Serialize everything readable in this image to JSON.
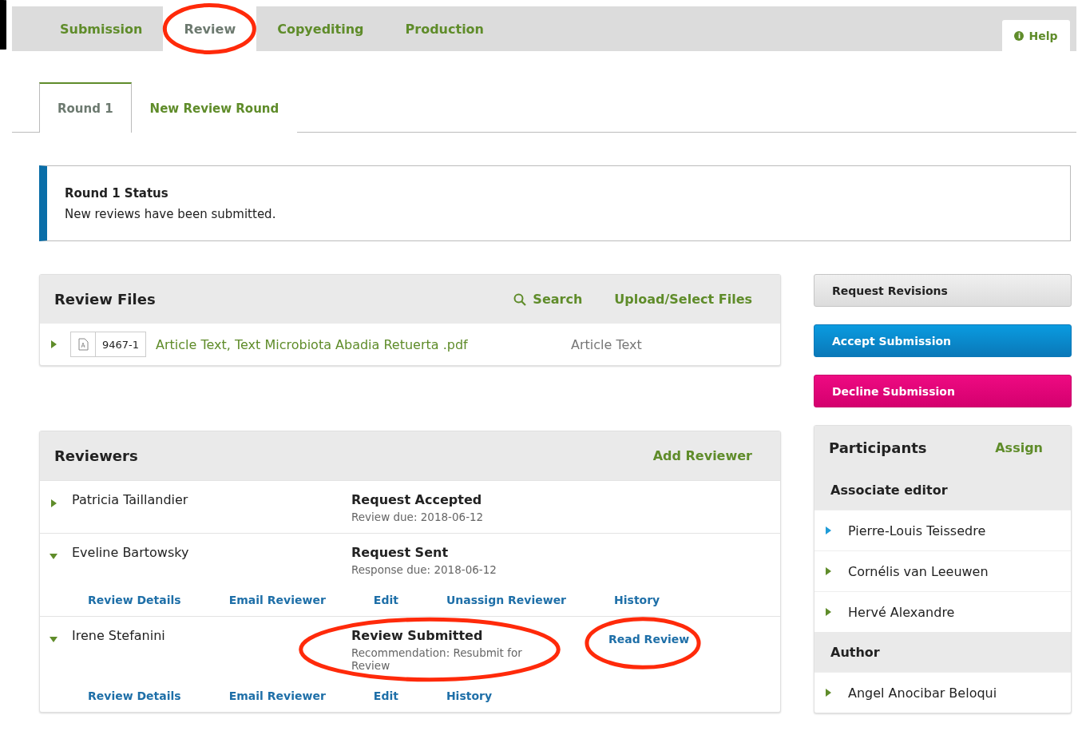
{
  "tabs": [
    {
      "label": "Submission",
      "selected": false,
      "circled": false
    },
    {
      "label": "Review",
      "selected": true,
      "circled": true
    },
    {
      "label": "Copyediting",
      "selected": false,
      "circled": false
    },
    {
      "label": "Production",
      "selected": false,
      "circled": false
    }
  ],
  "help": {
    "icon": "i",
    "label": "Help"
  },
  "round_tabs": [
    {
      "label": "Round 1",
      "selected": true
    },
    {
      "label": "New Review Round",
      "selected": false
    }
  ],
  "round_status": {
    "title": "Round 1 Status",
    "message": "New reviews have been submitted."
  },
  "review_files": {
    "title": "Review Files",
    "actions": [
      "Search",
      "Upload/Select Files"
    ],
    "files": [
      {
        "id": "9467-1",
        "name": "Article Text, Text Microbiota Abadia Retuerta .pdf",
        "type": "Article Text",
        "expanded": false
      }
    ]
  },
  "decisions": [
    {
      "label": "Request Revisions",
      "kind": "neutral"
    },
    {
      "label": "Accept Submission",
      "kind": "primary"
    },
    {
      "label": "Decline Submission",
      "kind": "danger"
    }
  ],
  "reviewers": {
    "title": "Reviewers",
    "action": "Add Reviewer",
    "rows": [
      {
        "name": "Patricia Taillandier",
        "status": "Request Accepted",
        "detail": "Review due: 2018-06-12",
        "expanded": false,
        "circled": false
      },
      {
        "name": "Eveline Bartowsky",
        "status": "Request Sent",
        "detail": "Response due: 2018-06-12",
        "expanded": true,
        "circled": false,
        "actions": [
          "Review Details",
          "Email Reviewer",
          "Edit",
          "Unassign Reviewer",
          "History"
        ]
      },
      {
        "name": "Irene Stefanini",
        "status": "Review Submitted",
        "detail": "Recommendation: Resubmit for Review",
        "expanded": true,
        "circled": true,
        "inline_action": {
          "label": "Read Review",
          "circled": true
        },
        "actions": [
          "Review Details",
          "Email Reviewer",
          "Edit",
          "History"
        ]
      }
    ]
  },
  "participants": {
    "title": "Participants",
    "action": "Assign",
    "groups": [
      {
        "role": "Associate editor",
        "people": [
          {
            "name": "Pierre-Louis Teissedre",
            "color": "#1e9bd7"
          },
          {
            "name": "Cornélis van Leeuwen",
            "color": "#5f8c2a"
          },
          {
            "name": "Hervé Alexandre",
            "color": "#5f8c2a"
          }
        ]
      },
      {
        "role": "Author",
        "people": [
          {
            "name": "Angel Anocibar Beloqui",
            "color": "#5f8c2a"
          }
        ]
      }
    ]
  }
}
